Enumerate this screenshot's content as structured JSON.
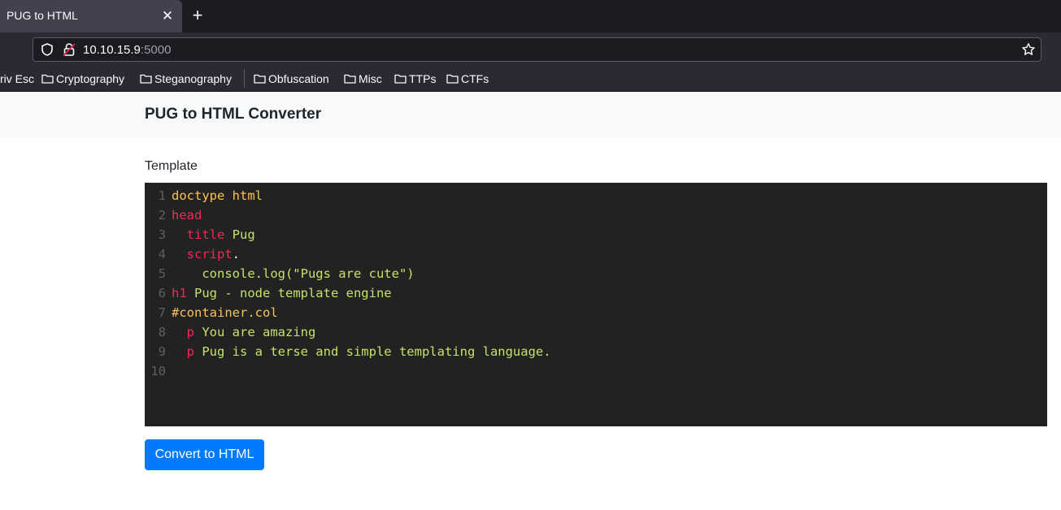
{
  "browser": {
    "tab_title": "PUG to HTML",
    "tab_close": "✕",
    "new_tab": "+",
    "url_host": "10.10.15.9",
    "url_port": ":5000",
    "bookmarks": [
      "riv Esc",
      "Cryptography",
      "Steganography",
      "Obfuscation",
      "Misc",
      "TTPs",
      "CTFs"
    ]
  },
  "page": {
    "title": "PUG to HTML Converter",
    "template_label": "Template",
    "convert_button": "Convert to HTML"
  },
  "editor": {
    "lines": [
      {
        "n": "1",
        "tokens": [
          {
            "t": "doctype",
            "c": "kw"
          },
          {
            "t": " html",
            "c": "kw"
          }
        ]
      },
      {
        "n": "2",
        "tokens": [
          {
            "t": "head",
            "c": "tag"
          }
        ]
      },
      {
        "n": "3",
        "tokens": [
          {
            "t": "  title",
            "c": "tag"
          },
          {
            "t": " Pug",
            "c": "txt"
          }
        ]
      },
      {
        "n": "4",
        "tokens": [
          {
            "t": "  script",
            "c": "tag"
          },
          {
            "t": ".",
            "c": "pun"
          }
        ]
      },
      {
        "n": "5",
        "tokens": [
          {
            "t": "    console.log(\"Pugs are cute\")",
            "c": "txt"
          }
        ]
      },
      {
        "n": "6",
        "tokens": [
          {
            "t": "h1",
            "c": "tag"
          },
          {
            "t": " Pug - node template engine",
            "c": "txt"
          }
        ]
      },
      {
        "n": "7",
        "tokens": [
          {
            "t": "#container.col",
            "c": "kw"
          }
        ]
      },
      {
        "n": "8",
        "tokens": [
          {
            "t": "  p",
            "c": "tag"
          },
          {
            "t": " You are amazing",
            "c": "txt"
          }
        ]
      },
      {
        "n": "9",
        "tokens": [
          {
            "t": "  p",
            "c": "tag"
          },
          {
            "t": " Pug is a terse and simple templating language.",
            "c": "txt"
          }
        ]
      },
      {
        "n": "10",
        "tokens": []
      }
    ]
  },
  "colors": {
    "accent": "#007bff",
    "editor_bg": "#222222",
    "tag": "#f9265a",
    "keyword": "#fcc255",
    "text": "#c4e36a"
  },
  "icons": {
    "shield": "shield-icon",
    "lock": "lock-insecure-icon",
    "star": "star-icon",
    "folder": "folder-icon",
    "close": "close-icon",
    "plus": "plus-icon"
  }
}
